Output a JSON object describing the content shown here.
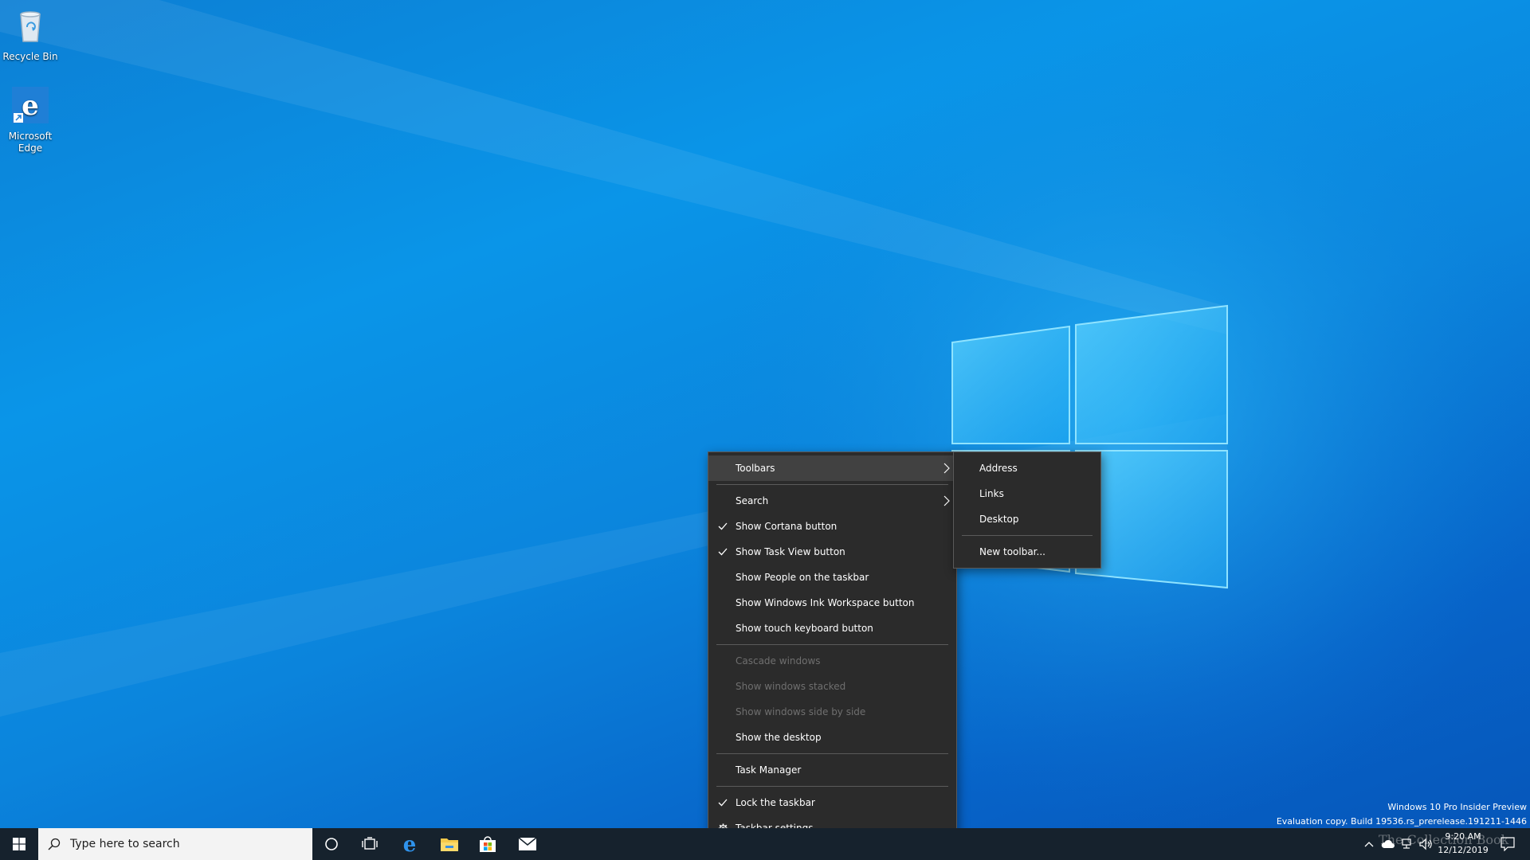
{
  "desktop": {
    "icons": [
      {
        "label": "Recycle Bin"
      },
      {
        "label": "Microsoft Edge"
      }
    ]
  },
  "context_menu": {
    "items": {
      "toolbars": "Toolbars",
      "search": "Search",
      "show_cortana": "Show Cortana button",
      "show_task_view": "Show Task View button",
      "show_people": "Show People on the taskbar",
      "show_ink": "Show Windows Ink Workspace button",
      "show_touch_keyboard": "Show touch keyboard button",
      "cascade": "Cascade windows",
      "stacked": "Show windows stacked",
      "side_by_side": "Show windows side by side",
      "show_desktop": "Show the desktop",
      "task_manager": "Task Manager",
      "lock_taskbar": "Lock the taskbar",
      "taskbar_settings": "Taskbar settings"
    },
    "checked": [
      "show_cortana",
      "show_task_view",
      "lock_taskbar"
    ],
    "disabled": [
      "cascade",
      "stacked",
      "side_by_side"
    ],
    "highlighted": "toolbars"
  },
  "submenu": {
    "items": {
      "address": "Address",
      "links": "Links",
      "desktop": "Desktop",
      "new_toolbar": "New toolbar..."
    }
  },
  "taskbar": {
    "search_placeholder": "Type here to search",
    "pinned": [
      "edge-icon",
      "file-explorer-icon",
      "store-icon",
      "mail-icon"
    ],
    "clock_time": "9:20 AM",
    "clock_date": "12/12/2019"
  },
  "watermark": {
    "line1": "Windows 10 Pro Insider Preview",
    "line2": "Evaluation copy. Build 19536.rs_prerelease.191211-1446"
  },
  "branding": {
    "text": "The Collection Book"
  },
  "colors": {
    "menu_bg": "#2b2b2b",
    "menu_highlight": "#414141",
    "taskbar_bg": "#16222d",
    "accent": "#0a84e0"
  }
}
